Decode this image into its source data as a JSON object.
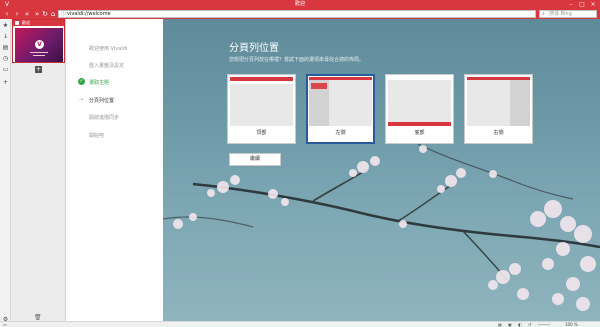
{
  "window": {
    "title": "歡迎"
  },
  "address": {
    "url": "vivaldi://welcome",
    "search_placeholder": "搜尋 Bing"
  },
  "tab": {
    "title": "歡迎"
  },
  "steps": [
    {
      "label": "歡迎使用 Vivaldi",
      "state": "pending"
    },
    {
      "label": "匯入書籤及設定",
      "state": "pending"
    },
    {
      "label": "選取主題",
      "state": "done"
    },
    {
      "label": "分頁列位置",
      "state": "current"
    },
    {
      "label": "開啟進階同步",
      "state": "pending"
    },
    {
      "label": "開始吧",
      "state": "pending"
    }
  ],
  "main": {
    "heading": "分頁列位置",
    "subtext": "您想把分頁列放在哪裡？嘗試下面的選項來尋找合適的佈局。",
    "options": [
      {
        "label": "頂部",
        "selected": false
      },
      {
        "label": "左側",
        "selected": true
      },
      {
        "label": "底部",
        "selected": false
      },
      {
        "label": "右側",
        "selected": false
      }
    ],
    "continue_label": "繼續"
  },
  "status": {
    "zoom": "100 %"
  },
  "colors": {
    "accent": "#d9373f",
    "selected_border": "#2a5a9c",
    "done": "#35a54a"
  }
}
